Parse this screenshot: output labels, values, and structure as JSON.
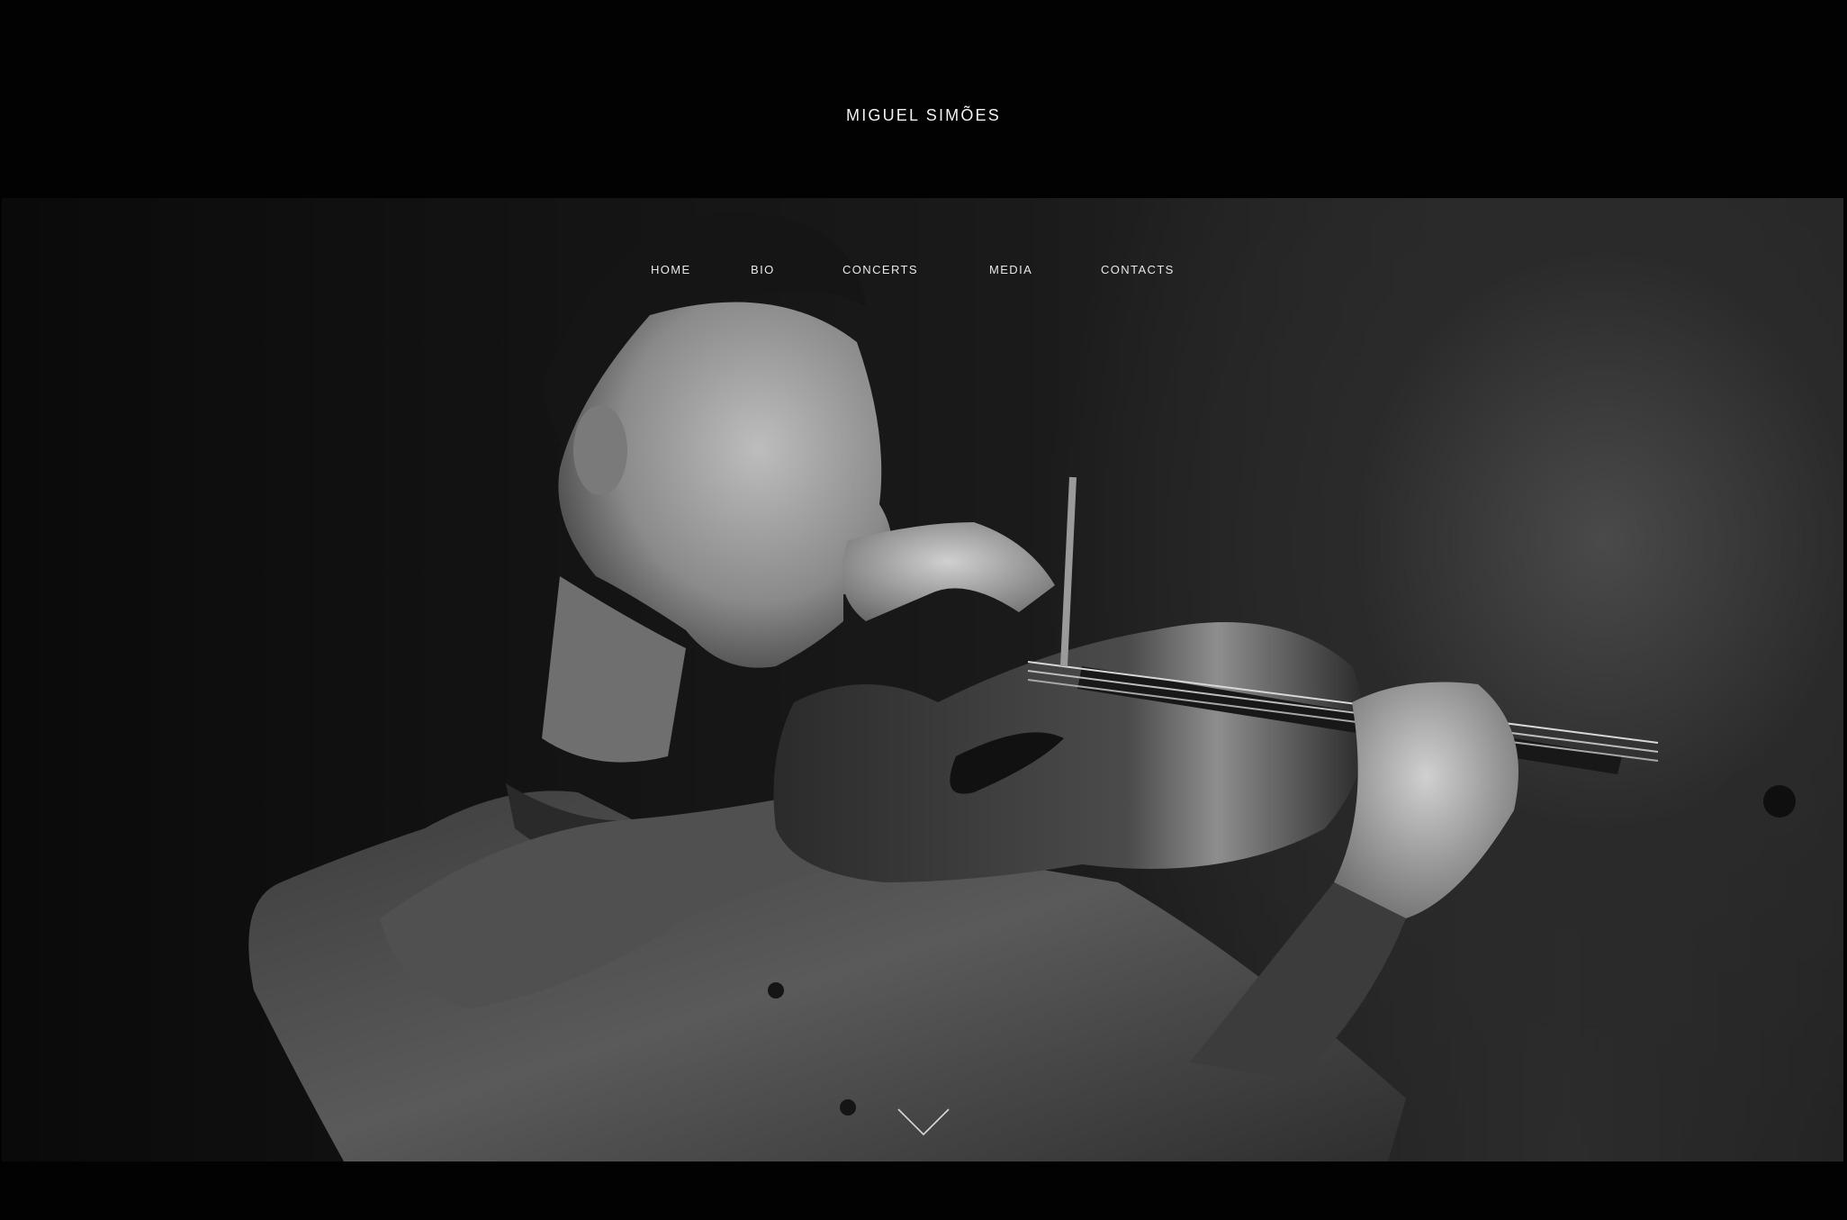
{
  "header": {
    "site_title": "MIGUEL SIMÕES"
  },
  "nav": {
    "items": [
      {
        "label": "HOME"
      },
      {
        "label": "BIO"
      },
      {
        "label": "CONCERTS"
      },
      {
        "label": "MEDIA"
      },
      {
        "label": "CONTACTS"
      }
    ]
  },
  "hero": {
    "photo_subject": "violinist-portrait",
    "scroll_icon": "chevron-down-icon"
  },
  "colors": {
    "background": "#020202",
    "text": "#f2f2f2"
  }
}
